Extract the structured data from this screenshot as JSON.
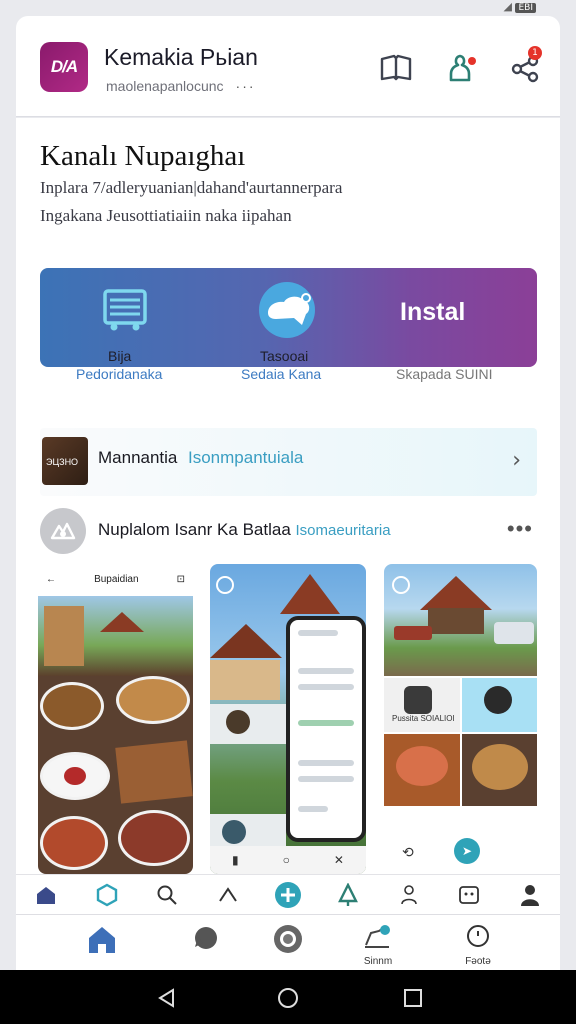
{
  "status_bar": {
    "battery": "ЁBI"
  },
  "header": {
    "logo_text": "D/A",
    "title": "Kemakia Pьian",
    "subtitle": "maolenapanlocunc",
    "more": "···",
    "icons": [
      "book-icon",
      "notification-person-icon",
      "share-icon"
    ],
    "badge_count": "1"
  },
  "main": {
    "title": "Kanalı Nupaıghaı",
    "description_line1": "Inplara 7/adlerуuanian|dahand'aurtannerpara",
    "description_line2": "Ingakana Jeusottiatiaiin naka iipahan",
    "banner": {
      "label_a": "Bija",
      "label_b": "Tasooai",
      "install": "Instal",
      "colors": [
        "#3c73b6",
        "#8b3f97"
      ]
    },
    "sub_labels": [
      "Pedoridanaka",
      "Sedaia Kana",
      "Skapada SUINI"
    ],
    "feature": {
      "thumb_text": "ЭЦЗНО",
      "title": "Mannantia",
      "subtitle": "Isonmpantuiala"
    },
    "post": {
      "title": "Nuplalom Isanr Ka Batlaa",
      "accent": "Isomaeuritaria",
      "more": "•••"
    },
    "screens": {
      "s1_title": "Bupaidian",
      "s3_label": "Pussita SOIALIOI"
    }
  },
  "top_nav_icons": [
    "home-icon",
    "hexagon-icon",
    "search-icon",
    "up-icon",
    "add-icon",
    "tree-icon",
    "person-outline-icon",
    "device-icon",
    "profile-icon"
  ],
  "bottom_nav": {
    "items": [
      {
        "icon": "home-icon",
        "label": ""
      },
      {
        "icon": "chat-icon",
        "label": ""
      },
      {
        "icon": "camera-icon",
        "label": ""
      },
      {
        "icon": "share-ring-icon",
        "label": "Sinnm"
      },
      {
        "icon": "clock-icon",
        "label": "Fəotə"
      }
    ]
  },
  "accent_color": "#2fa3b8"
}
